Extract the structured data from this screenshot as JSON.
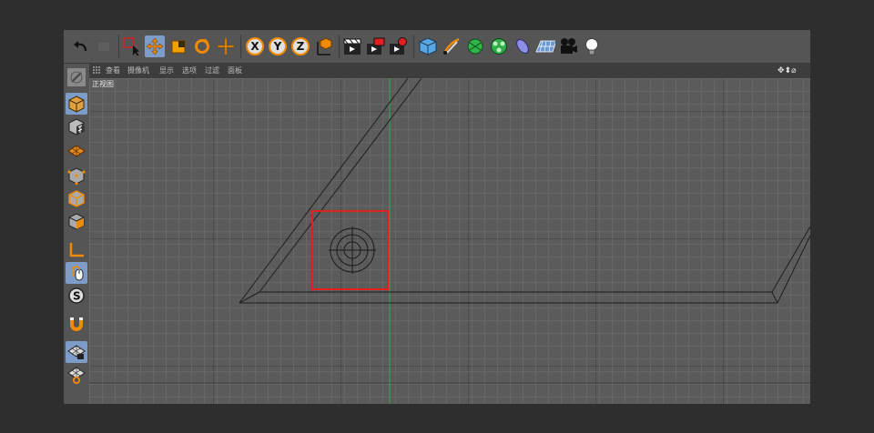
{
  "toolbar": {
    "undo_icon": "undo-icon",
    "redo_icon": "redo-icon",
    "tools": [
      "live-select-icon",
      "move-icon",
      "scale-icon",
      "rotate-icon",
      "last-tool-icon"
    ],
    "axis_labels": [
      "X",
      "Y",
      "Z"
    ],
    "coord_icon": "coordinate-system-icon",
    "render_icons": [
      "render-view-icon",
      "render-picture-viewer-icon",
      "render-settings-icon"
    ],
    "object_icons": [
      "cube-icon",
      "pen-icon",
      "subdivision-icon",
      "cloner-icon",
      "deformer-icon",
      "floor-icon",
      "camera-icon",
      "light-icon"
    ]
  },
  "viewport_menu": {
    "items": [
      "查看",
      "摄像机",
      "显示",
      "选项",
      "过滤",
      "面板"
    ],
    "nav_icons": "✥⬍⌀"
  },
  "viewport": {
    "view_label": "正视图"
  },
  "leftbar": {
    "icons": [
      "make-editable-icon",
      "model-mode-icon",
      "texture-mode-icon",
      "workplane-icon",
      "points-mode-icon",
      "edges-mode-icon",
      "polygons-mode-icon",
      "axis-mode-icon",
      "tweak-mode-icon",
      "solo-icon",
      "snap-icon",
      "lock-workplane-icon",
      "quantize-icon"
    ]
  },
  "colors": {
    "accent_orange": "#f08a00",
    "selection_blue": "#7d9cc8",
    "highlight_red": "#e21e1e",
    "y_axis_green": "#2fa84f"
  }
}
